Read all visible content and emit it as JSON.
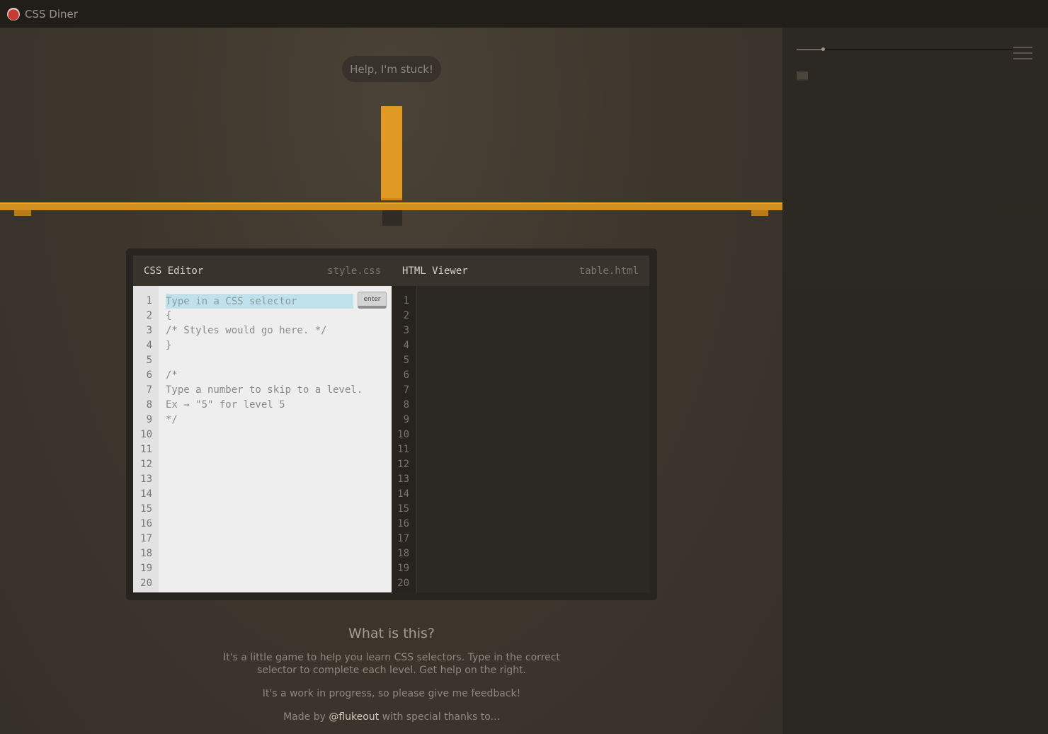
{
  "app": {
    "title": "CSS Diner"
  },
  "sidebar": {
    "progress_fraction": 0.12
  },
  "game": {
    "help_label": "Help, I'm stuck!"
  },
  "editor": {
    "css_title": "CSS Editor",
    "css_file": "style.css",
    "html_title": "HTML Viewer",
    "html_file": "table.html",
    "input_placeholder": "Type in a CSS selector",
    "enter_label": "enter",
    "line_numbers": [
      "1",
      "2",
      "3",
      "4",
      "5",
      "6",
      "7",
      "8",
      "9",
      "10",
      "11",
      "12",
      "13",
      "14",
      "15",
      "16",
      "17",
      "18",
      "19",
      "20"
    ],
    "css_lines": [
      "",
      "{",
      "/* Styles would go here. */",
      "}",
      "",
      "/*",
      "Type a number to skip to a level.",
      "Ex → \"5\" for level 5",
      "*/"
    ]
  },
  "info": {
    "heading": "What is this?",
    "para1": "It's a little game to help you learn CSS selectors. Type in the correct selector to complete each level. Get help on the right.",
    "para2": "It's a work in progress, so please give me feedback!",
    "credit_prefix": "Made by ",
    "credit_link": "@flukeout",
    "credit_suffix": " with special thanks to..."
  },
  "colors": {
    "accent": "#e09a24",
    "table": "#d08f1f",
    "logo_red": "#c73a33"
  }
}
